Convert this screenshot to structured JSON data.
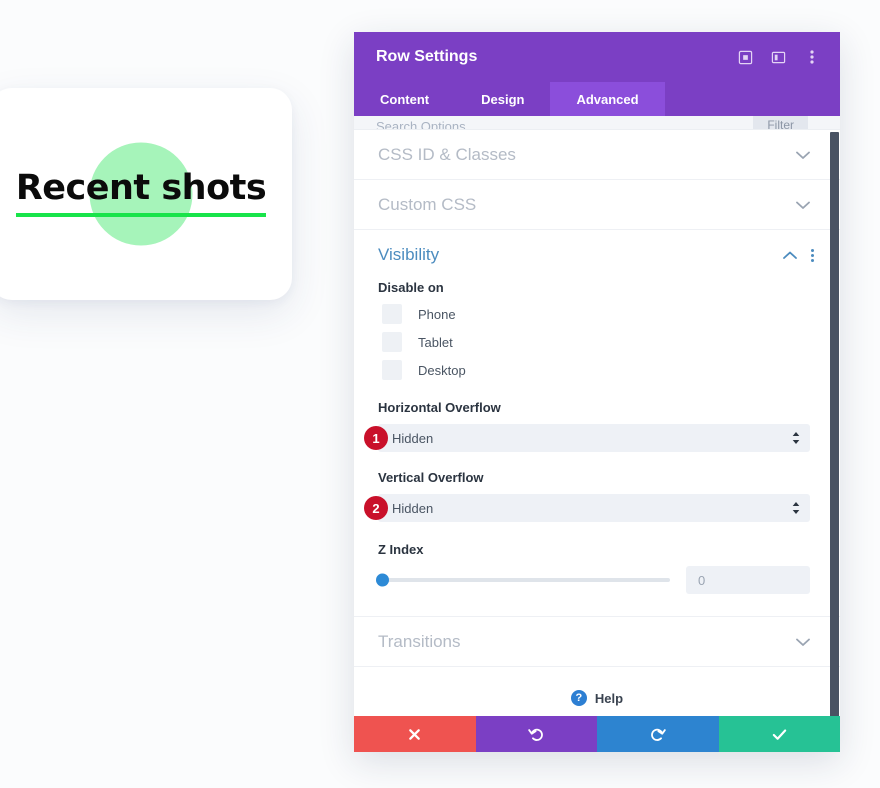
{
  "preview": {
    "title": "Recent shots",
    "accent_green": "#18e44a",
    "blob_green": "#a6f4ba"
  },
  "modal": {
    "title": "Row Settings",
    "header_color": "#7b3fc4",
    "header_icons": [
      {
        "name": "expand-icon",
        "glyph": "❑"
      },
      {
        "name": "layout-icon",
        "glyph": "▥"
      },
      {
        "name": "more-options-icon",
        "glyph": "⋮"
      }
    ],
    "tabs": [
      {
        "label": "Content",
        "active": false
      },
      {
        "label": "Design",
        "active": false
      },
      {
        "label": "Advanced",
        "active": true
      }
    ],
    "search": {
      "placeholder": "Search Options",
      "filter_label": "Filter"
    },
    "sections": [
      {
        "label": "CSS ID & Classes",
        "state": "collapsed"
      },
      {
        "label": "Custom CSS",
        "state": "collapsed"
      }
    ],
    "visibility": {
      "label": "Visibility",
      "disable_on_label": "Disable on",
      "devices": [
        {
          "label": "Phone",
          "checked": false
        },
        {
          "label": "Tablet",
          "checked": false
        },
        {
          "label": "Desktop",
          "checked": false
        }
      ],
      "horizontal_overflow": {
        "label": "Horizontal Overflow",
        "value": "Hidden",
        "badge": "1"
      },
      "vertical_overflow": {
        "label": "Vertical Overflow",
        "value": "Hidden",
        "badge": "2"
      },
      "z_index": {
        "label": "Z Index",
        "value": "0",
        "slider_position_percent": 0
      }
    },
    "transitions": {
      "label": "Transitions",
      "state": "collapsed"
    },
    "help": {
      "label": "Help",
      "icon": "?"
    },
    "footer_buttons": [
      {
        "name": "close-button",
        "glyph": "✖",
        "color": "#ef5350"
      },
      {
        "name": "undo-button",
        "glyph": "↺",
        "color": "#7b3fc4"
      },
      {
        "name": "redo-button",
        "glyph": "↻",
        "color": "#2d84d0"
      },
      {
        "name": "save-button",
        "glyph": "✔",
        "color": "#26c295"
      }
    ],
    "badge_color": "#c9102a"
  }
}
